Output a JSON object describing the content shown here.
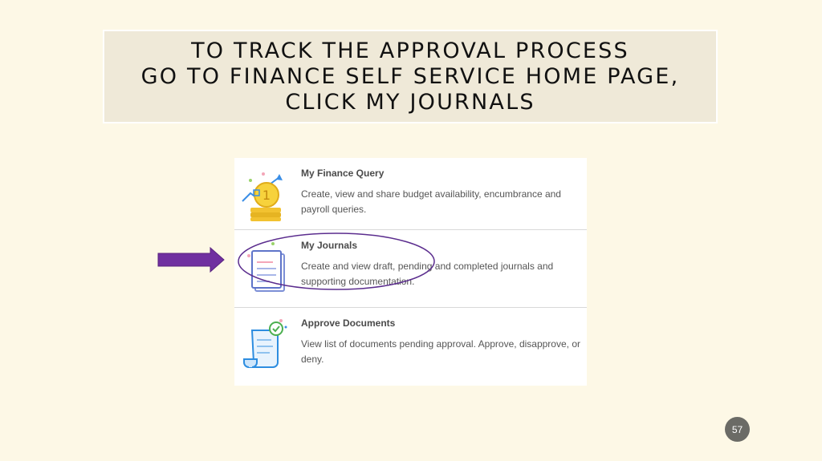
{
  "slide": {
    "title_lines": [
      "TO TRACK THE APPROVAL PROCESS",
      "GO TO FINANCE SELF SERVICE HOME PAGE,",
      "CLICK MY JOURNALS"
    ],
    "page_number": "57"
  },
  "cards": [
    {
      "title": "My Finance Query",
      "desc_lines": [
        "Create, view and share budget availability, encumbrance and",
        "payroll queries."
      ],
      "icon": "coin-chart-icon"
    },
    {
      "title": "My Journals",
      "desc_lines": [
        "Create and view draft, pending and completed journals and",
        "supporting documentation."
      ],
      "icon": "journal-icon"
    },
    {
      "title": "Approve Documents",
      "desc_lines": [
        "View list of documents pending approval. Approve, disapprove, or",
        "deny."
      ],
      "icon": "approve-document-icon"
    }
  ],
  "colors": {
    "background": "#fdf8e6",
    "title_box": "#efe9d8",
    "arrow": "#7030a0",
    "ellipse": "#5b2d8e"
  }
}
